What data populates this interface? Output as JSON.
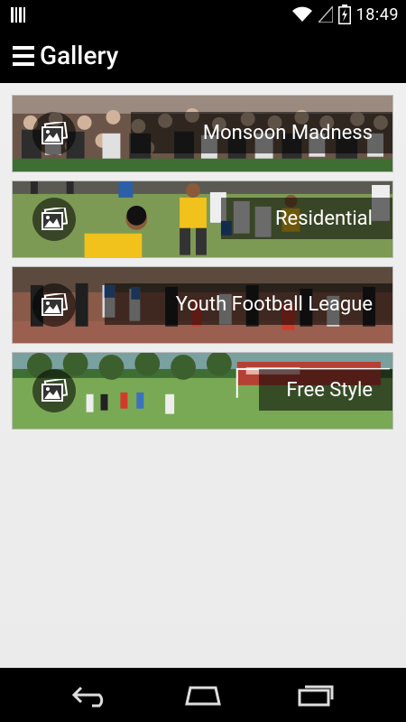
{
  "status_bar": {
    "time": "18:49",
    "icons": [
      "barcode-icon",
      "wifi-icon",
      "signal-icon",
      "battery-icon"
    ]
  },
  "app_bar": {
    "title": "Gallery",
    "menu_icon": "hamburger-menu-icon"
  },
  "gallery_items": [
    {
      "label": "Monsoon Madness"
    },
    {
      "label": "Residential"
    },
    {
      "label": "Youth Football League"
    },
    {
      "label": "Free Style"
    }
  ],
  "nav_bar": {
    "buttons": [
      "back-icon",
      "home-icon",
      "recent-apps-icon"
    ]
  }
}
